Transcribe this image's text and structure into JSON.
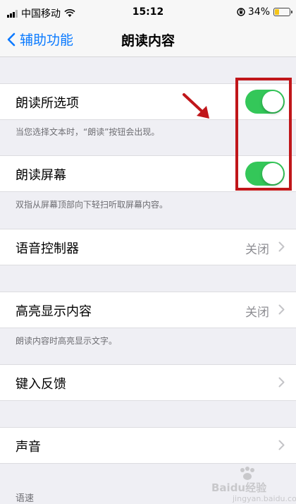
{
  "status_bar": {
    "carrier": "中国移动",
    "time": "15:12",
    "battery_percent": "34%",
    "battery_level": 0.34
  },
  "nav": {
    "back_label": "辅助功能",
    "title": "朗读内容"
  },
  "settings": {
    "speak_selection": {
      "label": "朗读所选项",
      "on": true,
      "footnote": "当您选择文本时，“朗读”按钮会出现。"
    },
    "speak_screen": {
      "label": "朗读屏幕",
      "on": true,
      "footnote": "双指从屏幕顶部向下轻扫听取屏幕内容。"
    },
    "speech_controller": {
      "label": "语音控制器",
      "value": "关闭"
    },
    "highlight_content": {
      "label": "高亮显示内容",
      "value": "关闭",
      "footnote": "朗读内容时高亮显示文字。"
    },
    "typing_feedback": {
      "label": "键入反馈"
    },
    "voices": {
      "label": "声音"
    },
    "speaking_rate_header": "语速"
  },
  "watermark": {
    "text": "Baidu经验",
    "sub": "jingyan.baidu.com"
  },
  "colors": {
    "accent": "#0a7aff",
    "toggle_on": "#34c759",
    "annotation": "#c0161a"
  }
}
